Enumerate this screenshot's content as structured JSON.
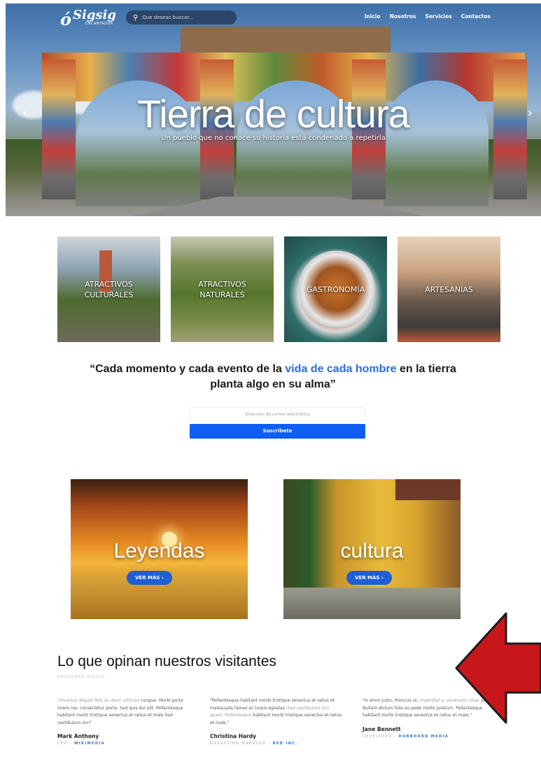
{
  "nav": {
    "logo_name": "Sigsig",
    "logo_tagline": "ENCANTADOR",
    "search_placeholder": "Que deseas buscar...",
    "menu": [
      "Inicio",
      "Nosotros",
      "Servicios",
      "Contactos"
    ]
  },
  "hero": {
    "title": "Tierra de cultura",
    "subtitle": "Un pueblo que no conoce su historia está condenado a repetirla",
    "prev_icon": "‹",
    "next_icon": "›"
  },
  "categories": [
    {
      "label": "ATRACTIVOS CULTURALES"
    },
    {
      "label": "ATRACTIVOS NATURALES"
    },
    {
      "label": "GASTRONOMÍA"
    },
    {
      "label": "ARTESANÍAS"
    }
  ],
  "quote": {
    "before": "“Cada momento y cada evento de la ",
    "highlight": "vida de cada hombre",
    "after": " en la tierra planta algo en su alma”"
  },
  "subscribe": {
    "email_placeholder": "Direccion de correo electrónico",
    "button": "Suscribete"
  },
  "features": [
    {
      "title": "Leyendas",
      "button": "VER MÁS"
    },
    {
      "title": "cultura",
      "button": "VER MÁS"
    }
  ],
  "testimonials": {
    "title": "Lo que opinan nuestros visitantes",
    "kicker": "DESCUBRE SIGSIG",
    "items": [
      {
        "quote_start": "\"Vivamus aliquet felis eu diam ultricies",
        "quote_rest": " congue. Morbi porta lorem nec consectetur porta. Sed quis dui elit. Pellentesque habitant morbi tristique senectus et netus et male Sed vestibulum orci\"",
        "name": "Mark Anthony",
        "role": "CEO - ",
        "company": "WIKIMEDIA"
      },
      {
        "quote_start": "\"Pellentesque habitant morbi tristique senectus et netus et malesuada fames ac turpis egestas. ",
        "quote_italic": "Sed vestibulum orci quam. Pellentesque",
        "quote_rest": " habitant morbi tristique senectus et netus et male.\"",
        "name": "Christina Hardy",
        "role": "MARKETING MANAGER - ",
        "company": "RED INC."
      },
      {
        "quote_start": "\"In enim justo, rhoncus ut, ",
        "quote_italic": "imperdiet a, venenatis vitae,",
        "quote_rest": " justo. Nullam dictum felis eu pede mollis pretium. Pellentesque habitant morbi tristique senectus et netus et male.\"",
        "name": "Jane Bennett",
        "role": "DEVELOPER - ",
        "company": "HUBBOARD MEDIA"
      }
    ]
  },
  "colors": {
    "accent": "#0d5ef2",
    "link": "#2a6fd6",
    "annotation_arrow": "#c8171b"
  }
}
